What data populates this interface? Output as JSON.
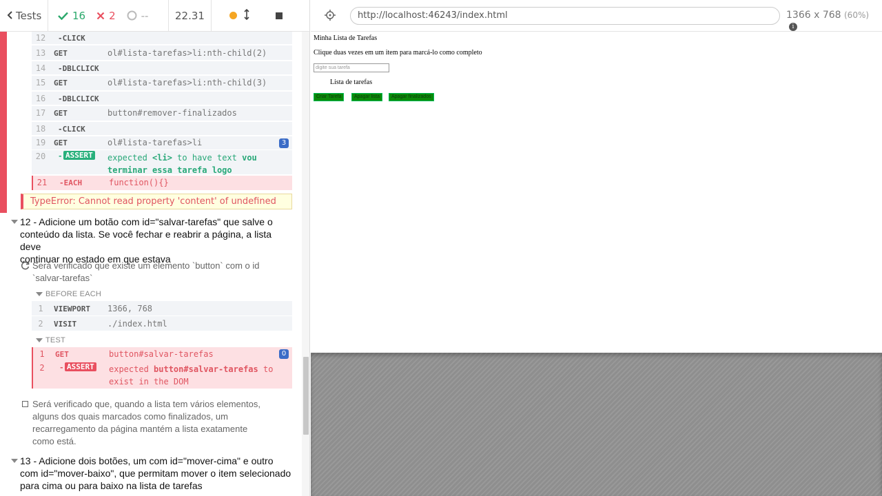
{
  "topbar": {
    "tests_label": "Tests",
    "passed": "16",
    "failed": "2",
    "pending": "--",
    "duration": "22.31"
  },
  "commands_upper": [
    {
      "n": "12",
      "name": "-CLICK",
      "msg": ""
    },
    {
      "n": "13",
      "name": "GET",
      "msg": "ol#lista-tarefas>li:nth-child(2)"
    },
    {
      "n": "14",
      "name": "-DBLCLICK",
      "msg": ""
    },
    {
      "n": "15",
      "name": "GET",
      "msg": "ol#lista-tarefas>li:nth-child(3)"
    },
    {
      "n": "16",
      "name": "-DBLCLICK",
      "msg": ""
    },
    {
      "n": "17",
      "name": "GET",
      "msg": "button#remover-finalizados"
    },
    {
      "n": "18",
      "name": "-CLICK",
      "msg": ""
    },
    {
      "n": "19",
      "name": "GET",
      "msg": "ol#lista-tarefas>li",
      "badge": "3"
    }
  ],
  "assert20": {
    "n": "20",
    "tag": "ASSERT",
    "prefix": "expected",
    "subject": "<li>",
    "middle": "to have text",
    "value1": "vou",
    "value2": "terminar essa tarefa logo"
  },
  "each21": {
    "n": "21",
    "name": "-EACH",
    "msg": "function(){}"
  },
  "error_message": "TypeError: Cannot read property 'content' of undefined",
  "suite12": {
    "line1": "12 - Adicione um botão com id=\"salvar-tarefas\" que salve o",
    "line2": "conteúdo da lista. Se você fechar e reabrir a página, a lista deve",
    "line3": "continuar no estado em que estava"
  },
  "test12a": {
    "line1": "Será verificado que existe um elemento `button` com o id",
    "line2": "`salvar-tarefas`"
  },
  "before_each_label": "BEFORE EACH",
  "before_each": [
    {
      "n": "1",
      "name": "VIEWPORT",
      "msg": "1366, 768"
    },
    {
      "n": "2",
      "name": "VISIT",
      "msg": "./index.html"
    }
  ],
  "test_label": "TEST",
  "test_cmds": [
    {
      "n": "1",
      "name": "GET",
      "msg": "button#salvar-tarefas",
      "badge": "0"
    }
  ],
  "assert_fail": {
    "n": "2",
    "tag": "ASSERT",
    "prefix": "expected",
    "subject": "button#salvar-tarefas",
    "suffix": "to",
    "line2": "exist in the DOM"
  },
  "test12b": {
    "line1": "Será verificado que, quando a lista tem vários elementos,",
    "line2": "alguns dos quais marcados como finalizados, um",
    "line3": "recarregamento da página mantém a lista exatamente",
    "line4": "como está."
  },
  "suite13": {
    "line1": "13 - Adicione dois botões, um com id=\"mover-cima\" e outro",
    "line2": "com id=\"mover-baixo\", que permitam mover o item selecionado",
    "line3": "para cima ou para baixo na lista de tarefas"
  },
  "aut": {
    "url": "http://localhost:46243/index.html",
    "viewport": "1366 x 768",
    "scale": "(60%)"
  },
  "site": {
    "title": "Minha Lista de Tarefas",
    "instructions": "Clique duas vezes em um item para marcá-lo como completo",
    "input_placeholder": "digite sua tarefa",
    "list_label": "Lista de tarefas",
    "btn_create": "Criar Tarefa",
    "btn_clear": "Apagar lista",
    "btn_remove_done": "Apagar finalizados"
  },
  "colors": {
    "pass": "#2aa86b",
    "fail": "#e94f5f",
    "badge": "#3b6cc7",
    "site_button": "#0a8a0a"
  }
}
